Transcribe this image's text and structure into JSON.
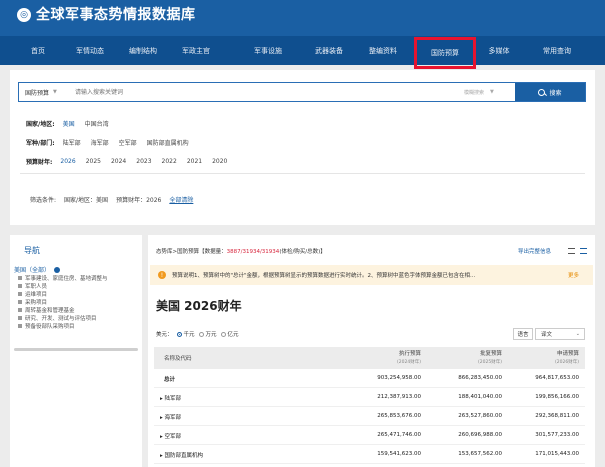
{
  "header": {
    "logo_glyph": "◎",
    "title": "全球军事态势情报数据库"
  },
  "nav": {
    "items": [
      {
        "label": "首页"
      },
      {
        "label": "军情动态"
      },
      {
        "label": "编制结构"
      },
      {
        "label": "军政主官"
      },
      {
        "label": "军事设施"
      },
      {
        "label": "武器装备"
      },
      {
        "label": "整编资料"
      },
      {
        "label": "国防预算",
        "active": true
      },
      {
        "label": "多媒体"
      },
      {
        "label": "常用查询"
      }
    ]
  },
  "search": {
    "category": "国防预算",
    "placeholder": "请输入搜索关键词",
    "mode": "模糊搜索",
    "button_label": "搜索"
  },
  "filters": {
    "country": {
      "label": "国家/地区:",
      "options": [
        "美国",
        "中国台湾"
      ]
    },
    "branch": {
      "label": "军种/部门:",
      "options": [
        "陆军部",
        "海军部",
        "空军部",
        "国防部直属机构"
      ]
    },
    "year": {
      "label": "预算财年:",
      "options": [
        "2026",
        "2025",
        "2024",
        "2023",
        "2022",
        "2021",
        "2020"
      ]
    },
    "criteria": {
      "label": "筛选条件:",
      "country": "国家/地区：美国",
      "year": "预算财年：2026",
      "clear": "全部清除"
    }
  },
  "nav_panel": {
    "title": "导航",
    "root": "美国（全部）",
    "items": [
      "军事建设、家庭住房、基地调整与",
      "军职人员",
      "运维项目",
      "采购项目",
      "周转基金和管理基金",
      "研究、开发、测试与评估项目",
      "预备役部队采购项目"
    ]
  },
  "main": {
    "breadcrumb_prefix": "态势库>国防预算【数据量：",
    "breadcrumb_count": "3887/31934/31934",
    "breadcrumb_suffix": "(体检/购买/总数)】",
    "export_label": "导出完整信息",
    "notice": "预算说明1、预算树中的\"总计\"金额，根据预算树显示的预算数据进行实时统计。2、预算树中蓝色字体预算金额已包含在相...",
    "notice_more": "更多",
    "page_title": "美国 2026财年",
    "unit_label": "美元：",
    "units": [
      "千元",
      "万元",
      "亿元"
    ],
    "unit_selected": 0,
    "lang_label": "语言",
    "lang_value": "译文",
    "table": {
      "columns": [
        {
          "title": "名称及代码"
        },
        {
          "title": "执行预算",
          "sub": "(2024财年)"
        },
        {
          "title": "批复预算",
          "sub": "(2025财年)"
        },
        {
          "title": "申请预算",
          "sub": "(2026财年)"
        }
      ],
      "rows": [
        {
          "name": "总计",
          "v1": "903,254,958.00",
          "v2": "866,283,450.00",
          "v3": "964,817,653.00",
          "bold": true
        },
        {
          "name": "▸ 陆军部",
          "v1": "212,387,913.00",
          "v2": "188,401,040.00",
          "v3": "199,856,166.00"
        },
        {
          "name": "▸ 海军部",
          "v1": "265,853,676.00",
          "v2": "263,527,860.00",
          "v3": "292,368,811.00"
        },
        {
          "name": "▸ 空军部",
          "v1": "265,471,746.00",
          "v2": "260,696,988.00",
          "v3": "301,577,233.00"
        },
        {
          "name": "▸ 国防部直属机构",
          "v1": "159,541,623.00",
          "v2": "153,657,562.00",
          "v3": "171,015,443.00"
        }
      ]
    }
  },
  "colors": {
    "primary": "#1a5fa3",
    "nav": "#0f4f8f",
    "highlight": "#e8142f",
    "notice_bg": "#fdf3df"
  }
}
